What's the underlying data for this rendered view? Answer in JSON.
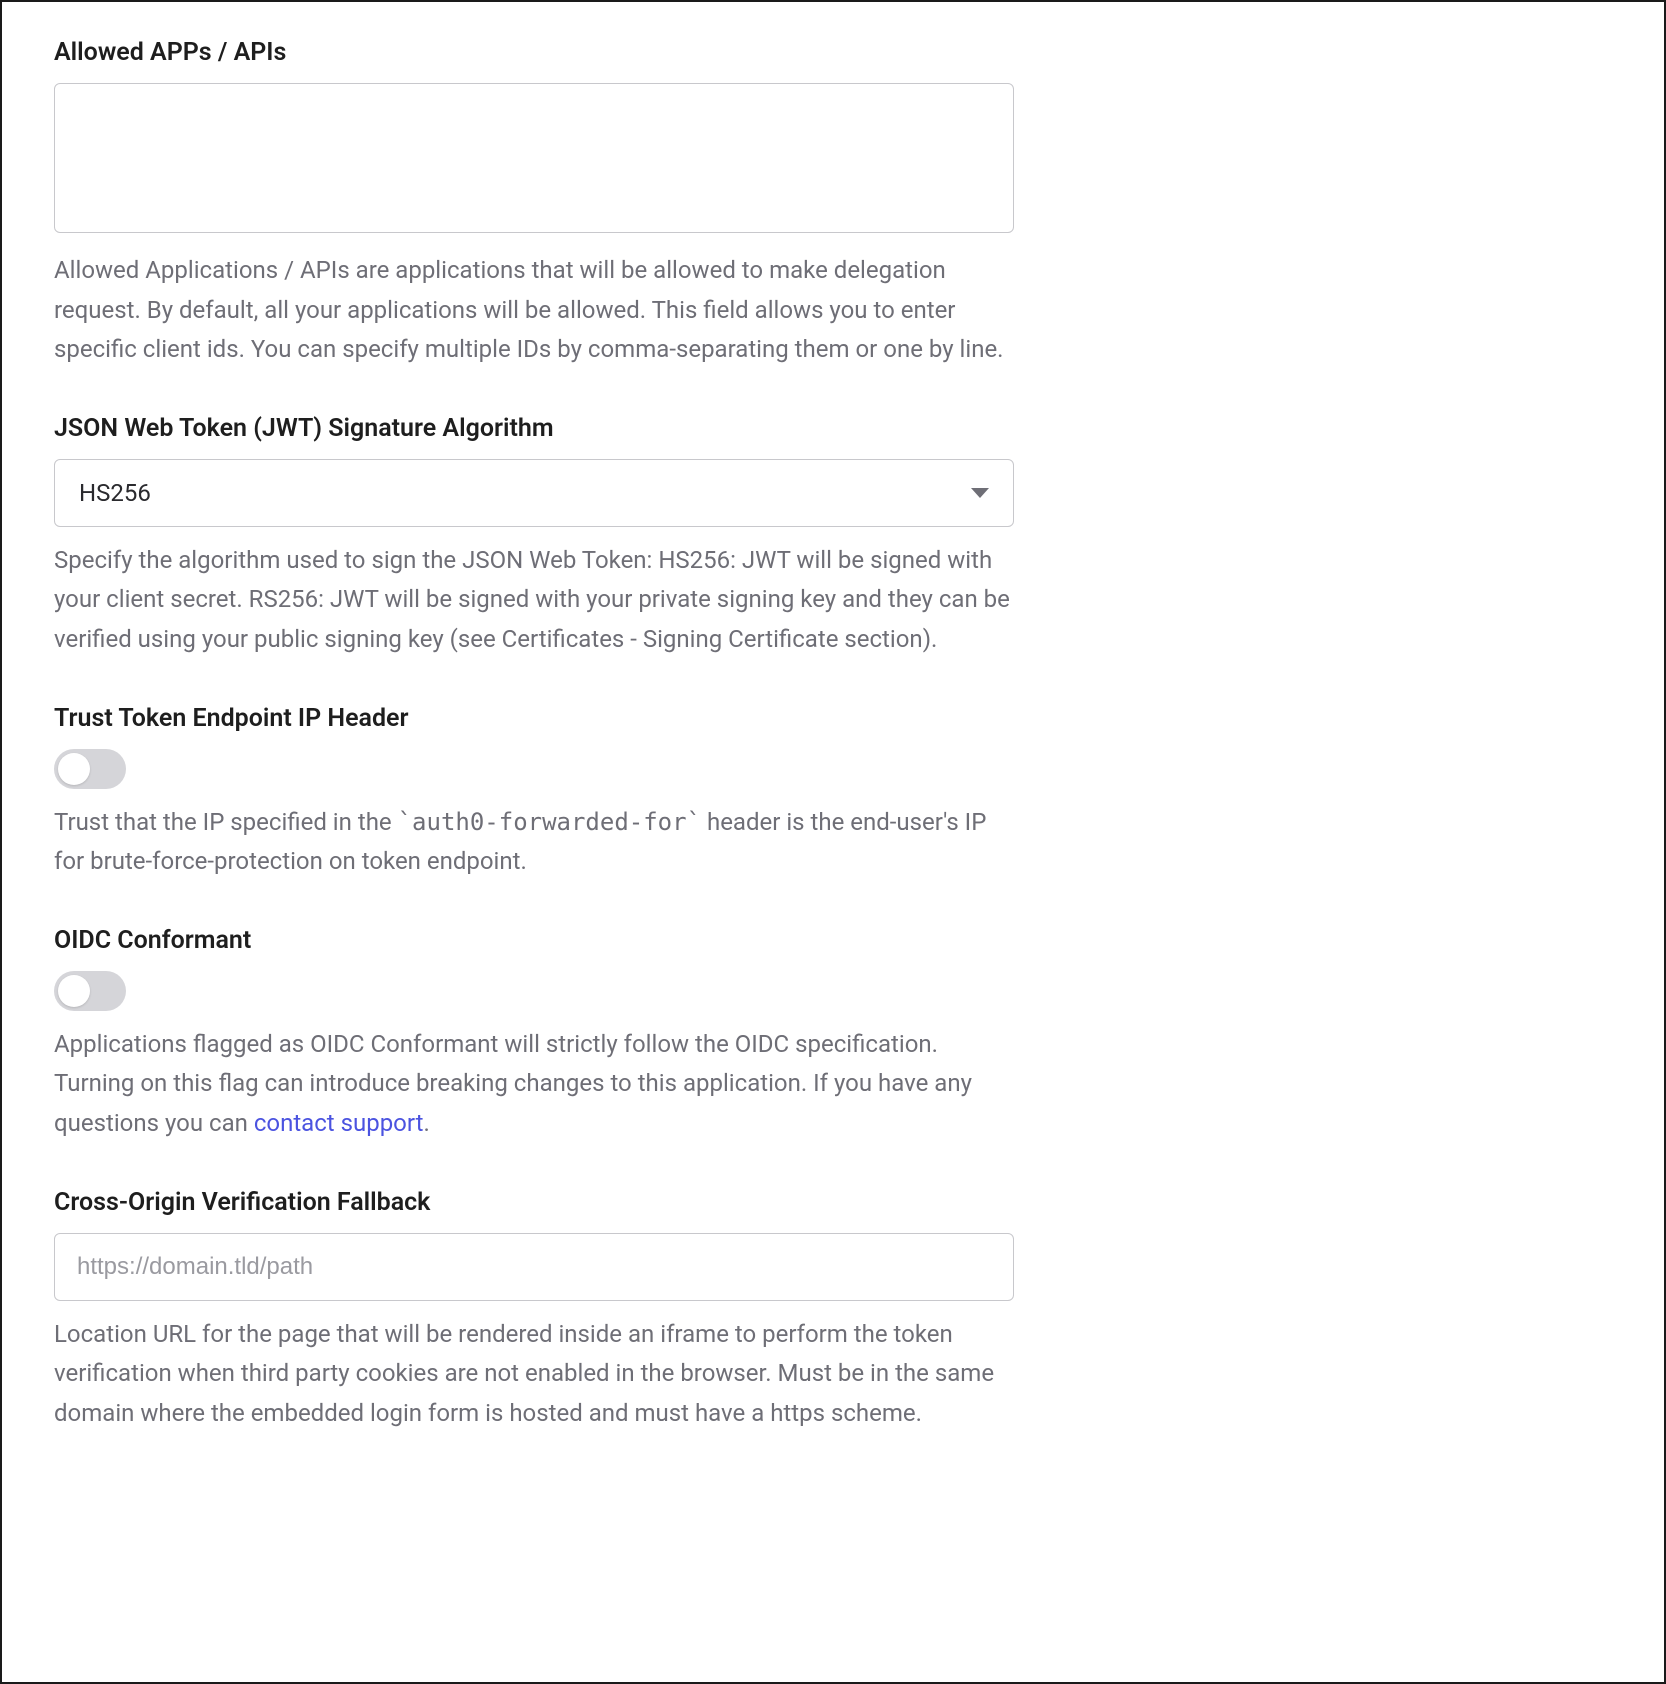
{
  "allowed_apps": {
    "label": "Allowed APPs / APIs",
    "value": "",
    "help": "Allowed Applications / APIs are applications that will be allowed to make delegation request. By default, all your applications will be allowed. This field allows you to enter specific client ids. You can specify multiple IDs by comma-separating them or one by line."
  },
  "jwt_algo": {
    "label": "JSON Web Token (JWT) Signature Algorithm",
    "value": "HS256",
    "help": "Specify the algorithm used to sign the JSON Web Token: HS256: JWT will be signed with your client secret. RS256: JWT will be signed with your private signing key and they can be verified using your public signing key (see Certificates - Signing Certificate section)."
  },
  "trust_ip": {
    "label": "Trust Token Endpoint IP Header",
    "enabled": false,
    "help_pre": "Trust that the IP specified in the ",
    "help_code": "`auth0-forwarded-for`",
    "help_post": " header is the end-user's IP for brute-force-protection on token endpoint."
  },
  "oidc": {
    "label": "OIDC Conformant",
    "enabled": false,
    "help_pre": "Applications flagged as OIDC Conformant will strictly follow the OIDC specification. Turning on this flag can introduce breaking changes to this application. If you have any questions you can ",
    "link_text": "contact support",
    "help_post": "."
  },
  "cross_origin": {
    "label": "Cross-Origin Verification Fallback",
    "value": "",
    "placeholder": "https://domain.tld/path",
    "help": "Location URL for the page that will be rendered inside an iframe to perform the token verification when third party cookies are not enabled in the browser. Must be in the same domain where the embedded login form is hosted and must have a https scheme."
  }
}
